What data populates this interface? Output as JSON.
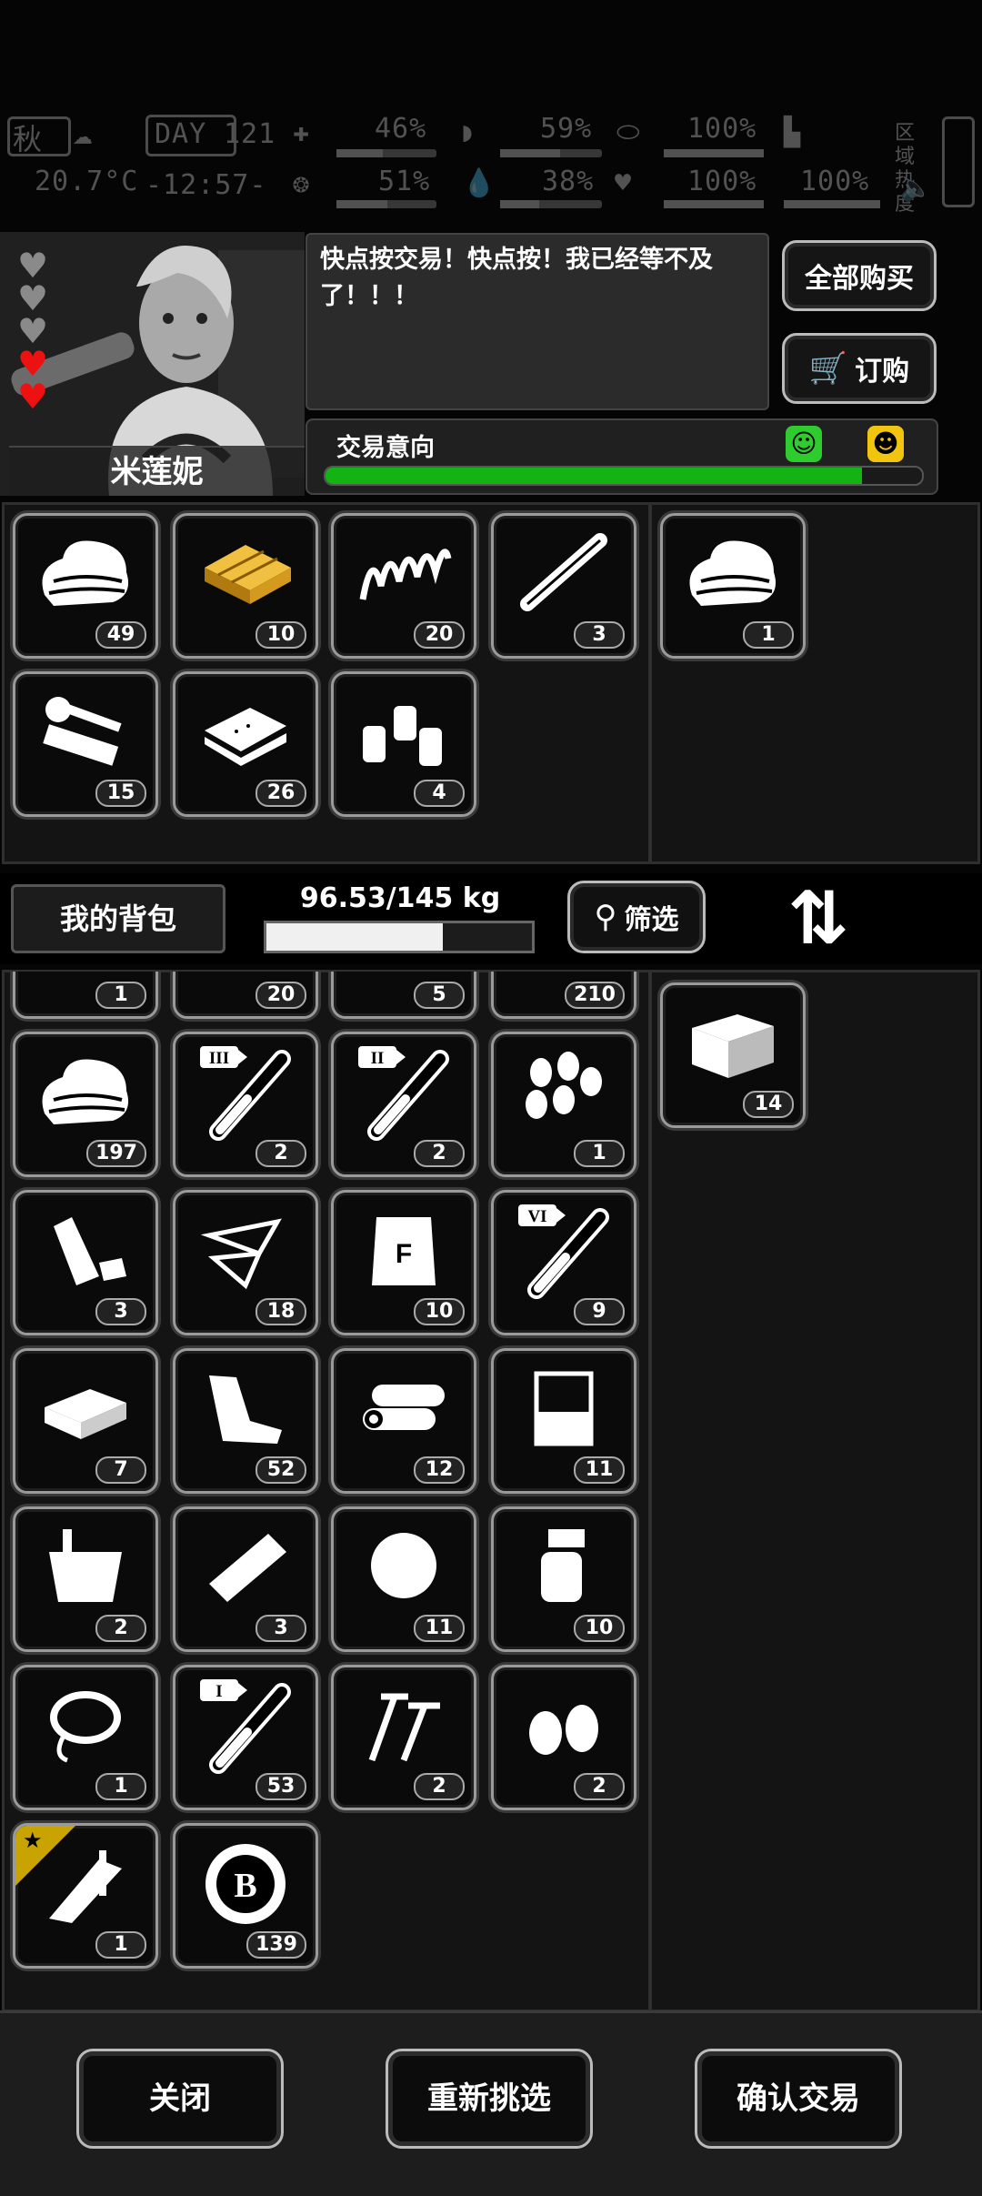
{
  "status": {
    "season": "秋",
    "day_label": "DAY",
    "day": "121",
    "temperature": "20.7°C",
    "clock": "-12:57-",
    "stats": [
      {
        "icon": "medkit-icon",
        "value": "46%"
      },
      {
        "icon": "stomach-icon",
        "value": "59%"
      },
      {
        "icon": "pill-icon",
        "value": "100%"
      },
      {
        "icon": "brain-icon",
        "value": "51%"
      },
      {
        "icon": "water-icon",
        "value": "38%"
      },
      {
        "icon": "heart-icon",
        "value": "100%"
      },
      {
        "icon": "stamina-icon",
        "value": "100%"
      }
    ],
    "zone_heat": "区域热度"
  },
  "trader": {
    "name": "米莲妮",
    "speech": "快点按交易！快点按！我已经等不及了！！！",
    "hearts_total": 5,
    "hearts_filled": 2,
    "intent_label": "交易意向",
    "intent_level": 0.9
  },
  "buttons": {
    "buy_all": "全部购买",
    "order": "订购",
    "my_bag": "我的背包",
    "filter": "筛选",
    "close": "关闭",
    "reselect": "重新挑选",
    "confirm": "确认交易"
  },
  "weight": "96.53/145 kg",
  "weight_ratio": 0.666,
  "trader_items": [
    {
      "icon": "cloth-icon",
      "count": "49"
    },
    {
      "icon": "wood-planks-icon",
      "count": "10"
    },
    {
      "icon": "spring-icon",
      "count": "20"
    },
    {
      "icon": "pipe-icon",
      "count": "3"
    },
    {
      "icon": "tools-icon",
      "count": "15"
    },
    {
      "icon": "bread-icon",
      "count": "26"
    },
    {
      "icon": "spice-bottles-icon",
      "count": "4"
    }
  ],
  "trader_offer": [
    {
      "icon": "cloth-icon",
      "count": "1"
    }
  ],
  "bag_items": [
    {
      "icon": "skewer-icon",
      "count": "1"
    },
    {
      "icon": "rags-icon",
      "count": "20"
    },
    {
      "icon": "paper-roll-icon",
      "count": "5"
    },
    {
      "icon": "meat-icon",
      "count": "210"
    },
    {
      "icon": "cloth-icon",
      "count": "197"
    },
    {
      "icon": "vial-iii-icon",
      "count": "2"
    },
    {
      "icon": "vial-ii-icon",
      "count": "2"
    },
    {
      "icon": "seeds-icon",
      "count": "1"
    },
    {
      "icon": "plastic-bottle-icon",
      "count": "3"
    },
    {
      "icon": "glass-shards-icon",
      "count": "18"
    },
    {
      "icon": "flour-sack-icon",
      "count": "10"
    },
    {
      "icon": "vial-vi-icon",
      "count": "9"
    },
    {
      "icon": "cash-icon",
      "count": "7"
    },
    {
      "icon": "scrap-fabric-icon",
      "count": "52"
    },
    {
      "icon": "logs-icon",
      "count": "12"
    },
    {
      "icon": "beaker-icon",
      "count": "11"
    },
    {
      "icon": "bucket-icon",
      "count": "2"
    },
    {
      "icon": "bandage-roll-icon",
      "count": "3"
    },
    {
      "icon": "cotton-icon",
      "count": "11"
    },
    {
      "icon": "spray-bottle-icon",
      "count": "10"
    },
    {
      "icon": "rope-icon",
      "count": "1"
    },
    {
      "icon": "vial-i-icon",
      "count": "53"
    },
    {
      "icon": "nails-icon",
      "count": "2"
    },
    {
      "icon": "earplugs-icon",
      "count": "2"
    },
    {
      "icon": "caliper-icon",
      "count": "1"
    },
    {
      "icon": "bitcoin-chip-icon",
      "count": "139"
    }
  ],
  "my_offer": [
    {
      "icon": "crate-icon",
      "count": "14"
    }
  ],
  "glyphs": {
    "vial-iii": "III",
    "vial-ii": "II",
    "vial-vi": "VI",
    "vial-i": "I",
    "flour": "F",
    "coin": "B",
    "star": "★",
    "swap": "⇅"
  }
}
